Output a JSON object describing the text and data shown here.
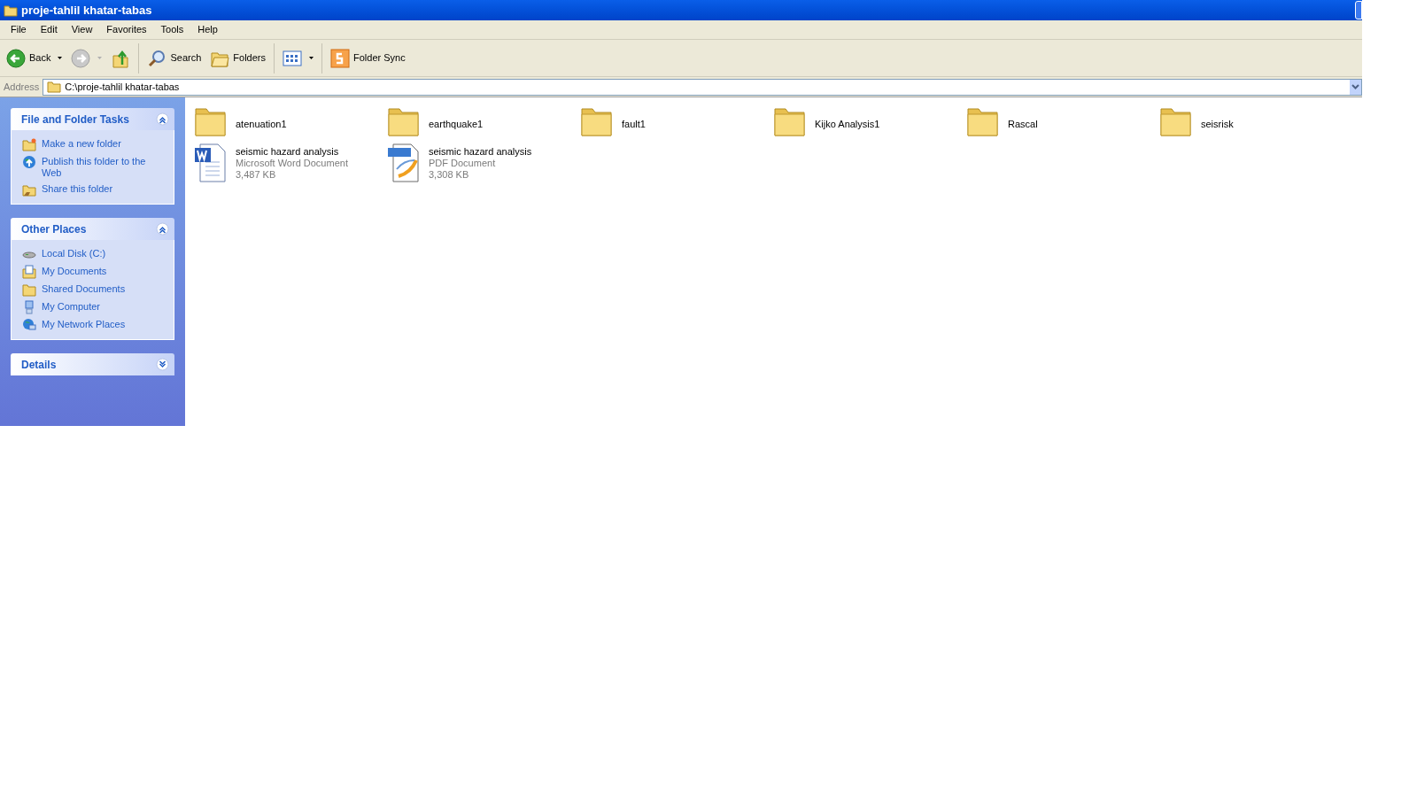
{
  "window": {
    "title": "proje-tahlil khatar-tabas"
  },
  "menu": [
    "File",
    "Edit",
    "View",
    "Favorites",
    "Tools",
    "Help"
  ],
  "toolbar": [
    {
      "kind": "back",
      "label": "Back",
      "dropdown": true,
      "disabled": false
    },
    {
      "kind": "forward",
      "dropdown": true,
      "disabled": true
    },
    {
      "kind": "up",
      "dropdown": false,
      "disabled": false
    },
    {
      "kind": "search",
      "label": "Search",
      "dropdown": false,
      "disabled": false
    },
    {
      "kind": "folders",
      "label": "Folders",
      "dropdown": false,
      "disabled": false
    },
    {
      "kind": "views",
      "dropdown": true,
      "disabled": false
    },
    {
      "kind": "sync",
      "label": "Folder Sync",
      "dropdown": false,
      "disabled": false
    }
  ],
  "address": {
    "label": "Address",
    "value": "C:\\proje-tahlil khatar-tabas"
  },
  "sidebar": [
    {
      "title": "File and Folder Tasks",
      "expanded": true,
      "items": [
        {
          "kind": "new-folder",
          "label": "Make a new folder"
        },
        {
          "kind": "publish",
          "label": "Publish this folder to the Web"
        },
        {
          "kind": "share",
          "label": "Share this folder"
        }
      ]
    },
    {
      "title": "Other Places",
      "expanded": true,
      "items": [
        {
          "kind": "disk",
          "label": "Local Disk (C:)"
        },
        {
          "kind": "documents",
          "label": "My Documents"
        },
        {
          "kind": "shared",
          "label": "Shared Documents"
        },
        {
          "kind": "computer",
          "label": "My Computer"
        },
        {
          "kind": "network",
          "label": "My Network Places"
        }
      ]
    },
    {
      "title": "Details",
      "expanded": false
    }
  ],
  "files": [
    {
      "kind": "folder",
      "name": "atenuation1"
    },
    {
      "kind": "folder",
      "name": "earthquake1"
    },
    {
      "kind": "folder",
      "name": "fault1"
    },
    {
      "kind": "folder",
      "name": "Kijko Analysis1"
    },
    {
      "kind": "folder",
      "name": "Rascal"
    },
    {
      "kind": "folder",
      "name": "seisrisk"
    },
    {
      "kind": "word",
      "name": "seismic hazard analysis",
      "type": "Microsoft Word Document",
      "size": "3,487 KB"
    },
    {
      "kind": "pdf",
      "name": "seismic hazard analysis",
      "type": "PDF Document",
      "size": "3,308 KB"
    }
  ]
}
